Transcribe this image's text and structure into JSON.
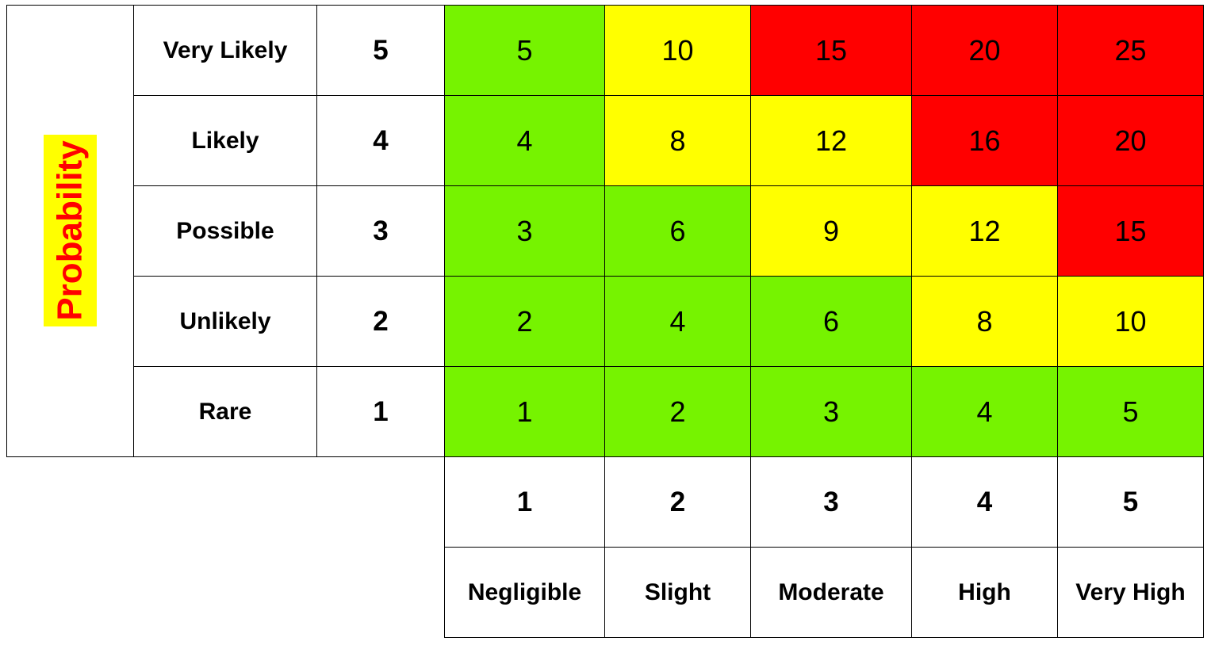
{
  "chart_data": {
    "type": "heatmap",
    "title": "",
    "ylabel": "Probability",
    "xlabel": "",
    "rows": [
      {
        "label": "Very Likely",
        "value": 5
      },
      {
        "label": "Likely",
        "value": 4
      },
      {
        "label": "Possible",
        "value": 3
      },
      {
        "label": "Unlikely",
        "value": 2
      },
      {
        "label": "Rare",
        "value": 1
      }
    ],
    "columns": [
      {
        "label": "Negligible",
        "value": 1
      },
      {
        "label": "Slight",
        "value": 2
      },
      {
        "label": "Moderate",
        "value": 3
      },
      {
        "label": "High",
        "value": 4
      },
      {
        "label": "Very High",
        "value": 5
      }
    ],
    "matrix": [
      [
        5,
        10,
        15,
        20,
        25
      ],
      [
        4,
        8,
        12,
        16,
        20
      ],
      [
        3,
        6,
        9,
        12,
        15
      ],
      [
        2,
        4,
        6,
        8,
        10
      ],
      [
        1,
        2,
        3,
        4,
        5
      ]
    ],
    "levels": [
      [
        1,
        2,
        3,
        3,
        3
      ],
      [
        1,
        2,
        2,
        3,
        3
      ],
      [
        1,
        1,
        2,
        2,
        3
      ],
      [
        1,
        1,
        1,
        2,
        2
      ],
      [
        1,
        1,
        1,
        1,
        1
      ]
    ],
    "level_colors": {
      "1": "#76F300",
      "2": "#FFFF00",
      "3": "#FF0000"
    },
    "label_colors": {
      "ylabel_text": "#FF0000",
      "ylabel_bg": "#FFFF00"
    }
  }
}
